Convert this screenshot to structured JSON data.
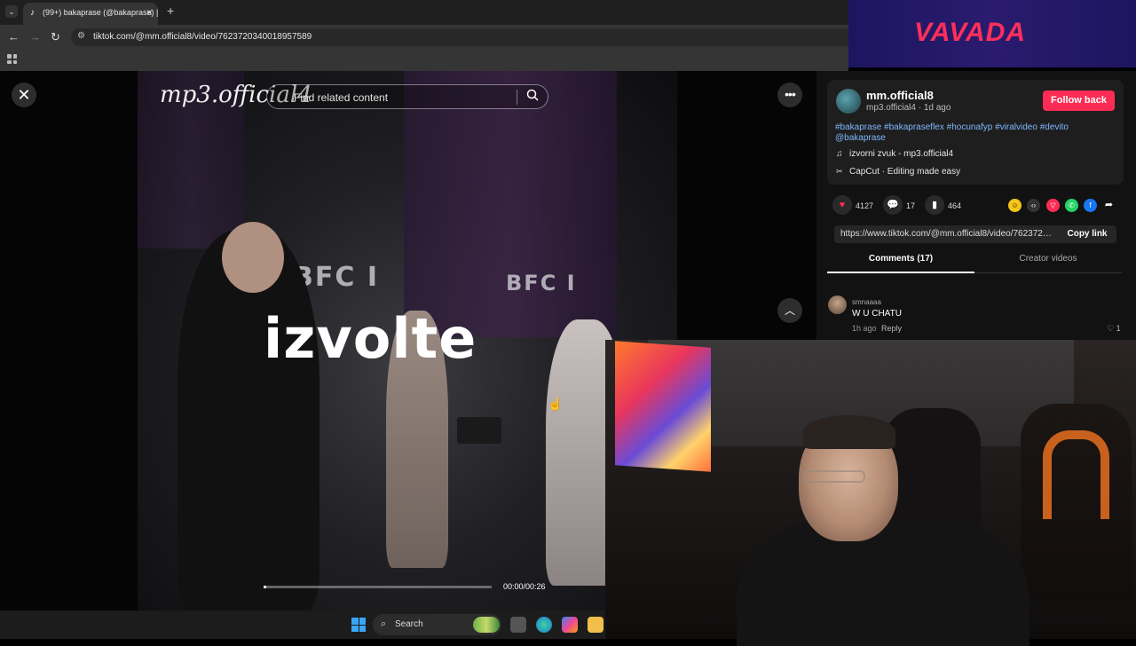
{
  "browser": {
    "tab_title": "(99+) bakaprase (@bakaprase) |",
    "tab_favicon": "tiktok-icon",
    "url": "tiktok.com/@mm.official8/video/7623720340018957589",
    "new_tab": "+"
  },
  "ad": {
    "logo_text": "VAVADA",
    "color": "#ff2f5a"
  },
  "video": {
    "watermark": "mp3.official4",
    "overlay_text": "izvolte",
    "search_placeholder": "Find related content",
    "time": "00:00/00:26",
    "progress": 0.0,
    "scene_text_left": "BFC I",
    "scene_text_right": "BFC I"
  },
  "post": {
    "username": "mm.official8",
    "subline": "mp3.official4 · 1d ago",
    "follow_label": "Follow back",
    "hashtags": "#bakaprase #bakapraseflex #hocunafyp #viralvideo #devito @bakaprase",
    "music": "izvorni zvuk - mp3.official4",
    "capcut": "CapCut · Editing made easy",
    "likes": "4127",
    "comments": "17",
    "saves": "464",
    "link": "https://www.tiktok.com/@mm.official8/video/7623720...",
    "copy_label": "Copy link",
    "accent": "#fe2c55"
  },
  "tabs": {
    "comments": "Comments (17)",
    "creator": "Creator videos"
  },
  "comment": {
    "user": "smnaaaa",
    "text": "W U CHATU",
    "time": "1h ago",
    "reply": "Reply",
    "likes": "1"
  },
  "taskbar": {
    "search_label": "Search"
  }
}
